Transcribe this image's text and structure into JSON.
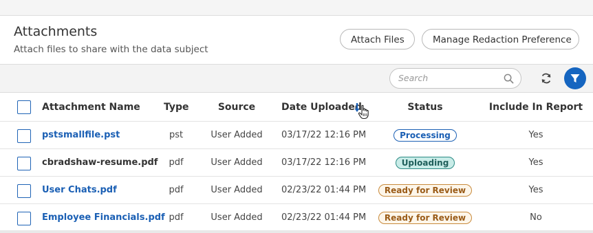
{
  "header": {
    "title": "Attachments",
    "subtitle": "Attach files to share with the data subject",
    "attach_button": "Attach Files",
    "redaction_button": "Manage Redaction Preference"
  },
  "toolbar": {
    "search_placeholder": "Search",
    "icons": [
      "search-icon",
      "refresh-icon",
      "filter-icon"
    ],
    "accent_color": "#1565c0"
  },
  "table": {
    "columns": [
      "Attachment Name",
      "Type",
      "Source",
      "Date Uploaded",
      "Status",
      "Include In Report"
    ],
    "sort_column": "Date Uploaded",
    "sort_direction": "descending",
    "rows": [
      {
        "name": "pstsmallfile.pst",
        "type": "pst",
        "source": "User Added",
        "date": "03/17/22 12:16 PM",
        "status": "Processing",
        "include": "Yes"
      },
      {
        "name": "cbradshaw-resume.pdf",
        "type": "pdf",
        "source": "User Added",
        "date": "03/17/22 12:16 PM",
        "status": "Uploading",
        "include": "Yes"
      },
      {
        "name": "User Chats.pdf",
        "type": "pdf",
        "source": "User Added",
        "date": "02/23/22 01:44 PM",
        "status": "Ready for Review",
        "include": "Yes"
      },
      {
        "name": "Employee Financials.pdf",
        "type": "pdf",
        "source": "User Added",
        "date": "02/23/22 01:44 PM",
        "status": "Ready for Review",
        "include": "No"
      }
    ]
  }
}
